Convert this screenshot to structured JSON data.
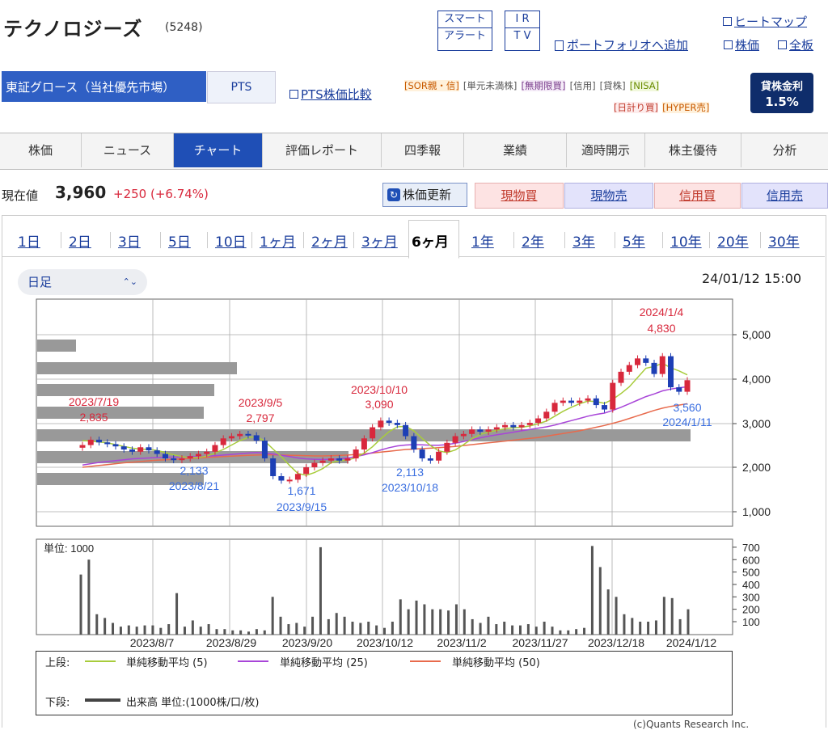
{
  "header": {
    "company_name": "テクノロジーズ",
    "code": "(5248)",
    "btn_smart_alert_line1": "スマート",
    "btn_smart_alert_line2": "アラート",
    "btn_ir_line1": "I R",
    "btn_ir_line2": "T V",
    "heatmap_link": "ヒートマップ",
    "portfolio_link": "ポートフォリオへ追加",
    "stock_link": "株価",
    "board_link": "全板"
  },
  "market": {
    "selected": "東証グロース（当社優先市場）",
    "pts_label": "PTS",
    "pts_compare_link": "PTS株価比較",
    "tags_row1": [
      "[SOR親・信]",
      "[単元未満株]",
      "[無期限買]",
      "[信用]",
      "[貸株]",
      "[NISA]"
    ],
    "tags_row2": [
      "[日計り買]",
      "[HYPER売]"
    ],
    "tag_colors": [
      "#c85a00",
      "#555555",
      "#7a3d8c",
      "#555555",
      "#555555",
      "#6a8c00",
      "#c0392b",
      "#c85a00"
    ],
    "lending_title": "貸株金利",
    "lending_value": "1.5%"
  },
  "tabs": [
    "株価",
    "ニュース",
    "チャート",
    "評価レポート",
    "四季報",
    "業績",
    "適時開示",
    "株主優待",
    "分析"
  ],
  "active_tab": "チャート",
  "quote": {
    "label": "現在値",
    "price": "3,960",
    "change": "+250 (+6.74%)",
    "refresh_label": "株価更新",
    "actions": [
      "現物買",
      "現物売",
      "信用買",
      "信用売"
    ]
  },
  "periods": [
    "1日",
    "2日",
    "3日",
    "5日",
    "10日",
    "1ヶ月",
    "2ヶ月",
    "3ヶ月",
    "6ヶ月",
    "1年",
    "2年",
    "3年",
    "5年",
    "10年",
    "20年",
    "30年"
  ],
  "active_period": "6ヶ月",
  "chart_header": {
    "interval": "日足",
    "timestamp": "24/01/12 15:00"
  },
  "chart_data": {
    "type": "candlestick",
    "price_axis": {
      "ticks": [
        "5,000",
        "4,000",
        "3,000",
        "2,000",
        "1,000"
      ]
    },
    "volume_axis": {
      "unit_label": "単位: 1000",
      "ticks": [
        "700",
        "600",
        "500",
        "400",
        "300",
        "200",
        "100"
      ]
    },
    "x_labels": [
      "2023/8/7",
      "2023/8/29",
      "2023/9/20",
      "2023/10/12",
      "2023/11/2",
      "2023/11/27",
      "2023/12/18",
      "2024/1/12"
    ],
    "close_series": [
      2500,
      2620,
      2560,
      2520,
      2470,
      2400,
      2350,
      2450,
      2380,
      2300,
      2200,
      2160,
      2200,
      2250,
      2300,
      2350,
      2500,
      2650,
      2700,
      2750,
      2720,
      2600,
      2200,
      1800,
      1700,
      1720,
      1850,
      2000,
      2100,
      2150,
      2200,
      2150,
      2200,
      2400,
      2650,
      2900,
      3050,
      3000,
      2950,
      2700,
      2400,
      2200,
      2150,
      2350,
      2550,
      2700,
      2750,
      2850,
      2800,
      2850,
      2900,
      2950,
      2900,
      2950,
      3000,
      3100,
      3250,
      3450,
      3500,
      3450,
      3500,
      3550,
      3400,
      3300,
      3900,
      4150,
      4300,
      4450,
      4350,
      4100,
      4500,
      3800,
      3700,
      3960
    ],
    "sma5": [
      2600,
      2590,
      2570,
      2550,
      2510,
      2470,
      2430,
      2410,
      2400,
      2380,
      2330,
      2280,
      2240,
      2220,
      2220,
      2250,
      2320,
      2400,
      2500,
      2600,
      2670,
      2690,
      2590,
      2410,
      2240,
      2040,
      1860,
      1820,
      1880,
      1970,
      2100,
      2150,
      2160,
      2220,
      2320,
      2460,
      2640,
      2800,
      2910,
      2920,
      2820,
      2650,
      2490,
      2370,
      2330,
      2390,
      2510,
      2640,
      2740,
      2790,
      2830,
      2870,
      2890,
      2900,
      2930,
      2980,
      3040,
      3150,
      3260,
      3350,
      3430,
      3490,
      3480,
      3440,
      3530,
      3660,
      3810,
      4020,
      4230,
      4270,
      4340,
      4240,
      4170,
      4080
    ],
    "sma25": [
      2050,
      2080,
      2110,
      2130,
      2150,
      2170,
      2190,
      2200,
      2210,
      2220,
      2225,
      2230,
      2235,
      2240,
      2245,
      2250,
      2260,
      2275,
      2290,
      2305,
      2320,
      2330,
      2320,
      2300,
      2270,
      2240,
      2210,
      2190,
      2180,
      2175,
      2180,
      2190,
      2210,
      2240,
      2280,
      2330,
      2390,
      2440,
      2480,
      2500,
      2510,
      2505,
      2495,
      2495,
      2510,
      2540,
      2580,
      2620,
      2660,
      2700,
      2730,
      2760,
      2790,
      2820,
      2850,
      2880,
      2910,
      2950,
      3000,
      3050,
      3100,
      3150,
      3190,
      3220,
      3280,
      3350,
      3430,
      3510,
      3590,
      3650,
      3720,
      3760,
      3790,
      3810
    ],
    "sma50": [
      2000,
      2020,
      2040,
      2060,
      2080,
      2100,
      2115,
      2130,
      2145,
      2160,
      2170,
      2180,
      2190,
      2200,
      2210,
      2220,
      2230,
      2240,
      2250,
      2260,
      2270,
      2275,
      2280,
      2280,
      2275,
      2270,
      2265,
      2260,
      2255,
      2255,
      2260,
      2265,
      2275,
      2285,
      2300,
      2320,
      2340,
      2360,
      2380,
      2400,
      2410,
      2420,
      2430,
      2440,
      2455,
      2470,
      2490,
      2510,
      2530,
      2550,
      2570,
      2590,
      2610,
      2630,
      2650,
      2670,
      2700,
      2730,
      2760,
      2790,
      2820,
      2860,
      2900,
      2940,
      2990,
      3040,
      3100,
      3160,
      3220,
      3280,
      3330,
      3370,
      3400,
      3430
    ],
    "volume": [
      480,
      600,
      160,
      130,
      90,
      60,
      70,
      60,
      70,
      70,
      50,
      80,
      330,
      60,
      110,
      60,
      80,
      40,
      40,
      30,
      30,
      20,
      40,
      30,
      300,
      140,
      80,
      90,
      60,
      140,
      700,
      120,
      170,
      140,
      100,
      90,
      100,
      70,
      50,
      100,
      280,
      200,
      270,
      240,
      200,
      200,
      190,
      240,
      200,
      120,
      90,
      140,
      80,
      100,
      70,
      70,
      80,
      60,
      100,
      60,
      30,
      30,
      40,
      50,
      710,
      540,
      360,
      300,
      160,
      130,
      100,
      100,
      110,
      300,
      290,
      120,
      200
    ],
    "annotations": [
      {
        "label": "2023/7/19",
        "value": "2,835"
      },
      {
        "label": "2023/9/5",
        "value": "2,797"
      },
      {
        "label": "2023/10/10",
        "value": "3,090"
      },
      {
        "label": "2024/1/4",
        "value": "4,830"
      },
      {
        "value": "2,133",
        "label": "2023/8/21"
      },
      {
        "value": "1,671",
        "label": "2023/9/15"
      },
      {
        "value": "2,113",
        "label": "2023/10/18"
      },
      {
        "value": "3,560",
        "label": "2024/1/11"
      }
    ],
    "legend": {
      "top_prefix": "上段:",
      "items": [
        {
          "name": "単純移動平均 (5)",
          "color": "#a8cc3c"
        },
        {
          "name": "単純移動平均 (25)",
          "color": "#a845d8"
        },
        {
          "name": "単純移動平均 (50)",
          "color": "#e86a4c"
        }
      ],
      "bottom_prefix": "下段:",
      "volume_name": "出来高 単位:(1000株/口/枚)"
    },
    "colors": {
      "up": "#d8283c",
      "down": "#1d3fb5",
      "volume": "#555555"
    }
  },
  "footer": {
    "credit": "(c)Quants Research Inc."
  }
}
